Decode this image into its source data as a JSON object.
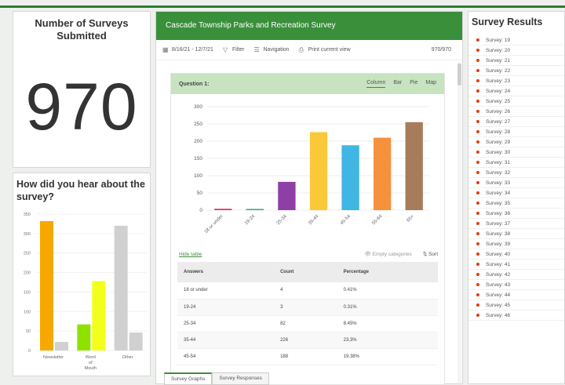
{
  "count_panel": {
    "title": "Number of Surveys Submitted",
    "value": "970"
  },
  "source_panel": {
    "title": "How did you hear about the survey?",
    "chart_data": {
      "type": "bar",
      "categories": [
        "Newsletter",
        "Word of Mouth",
        "Other"
      ],
      "category_labels": [
        "Newsletter",
        "Word\nof\nMouth",
        "Other"
      ],
      "series": [
        {
          "values": [
            332,
            67,
            320
          ],
          "colors": [
            "#f7a800",
            "#8fe200",
            "#d0d0d0"
          ]
        },
        {
          "values": [
            22,
            178,
            46
          ],
          "colors": [
            "#d0d0d0",
            "#f3ff1a",
            "#d0d0d0"
          ]
        }
      ],
      "ylim": [
        0,
        350
      ],
      "yticks": [
        0,
        50,
        100,
        150,
        200,
        250,
        300,
        350
      ]
    }
  },
  "survey": {
    "header": "Cascade Township Parks and Recreation Survey",
    "toolbar": {
      "date_range": "8/16/21 - 12/7/21",
      "filter": "Filter",
      "navigation": "Navigation",
      "print": "Print current view",
      "count": "970/970"
    },
    "question": {
      "title": "Question 1:",
      "tabs": [
        "Column",
        "Bar",
        "Pie",
        "Map"
      ],
      "active_tab": "Column"
    },
    "chart_data": {
      "type": "bar",
      "categories": [
        "18 or under",
        "19-24",
        "25-34",
        "35-44",
        "45-54",
        "55-64",
        "65+"
      ],
      "values": [
        4,
        3,
        82,
        226,
        188,
        210,
        255
      ],
      "colors": [
        "#e0365f",
        "#2aa898",
        "#8e3fa6",
        "#f9c93a",
        "#3fb6e3",
        "#f6913c",
        "#a67c5b"
      ],
      "ylim": [
        0,
        300
      ],
      "yticks": [
        0,
        50,
        100,
        150,
        200,
        250,
        300
      ]
    },
    "hide_table": "Hide table",
    "empty_categories": "Empty categories",
    "sort": "Sort",
    "table": {
      "headers": [
        "Answers",
        "Count",
        "Percentage"
      ],
      "rows": [
        [
          "18 or under",
          "4",
          "0.41%"
        ],
        [
          "19-24",
          "3",
          "0.31%"
        ],
        [
          "25-34",
          "82",
          "8.45%"
        ],
        [
          "35-44",
          "226",
          "23.3%"
        ],
        [
          "45-54",
          "188",
          "19.38%"
        ]
      ]
    },
    "bottom_tabs": [
      "Survey Graphs",
      "Survey Responses"
    ]
  },
  "results": {
    "title": "Survey Results",
    "items": [
      "Survey: 19",
      "Survey: 20",
      "Survey: 21",
      "Survey: 22",
      "Survey: 23",
      "Survey: 24",
      "Survey: 25",
      "Survey: 26",
      "Survey: 27",
      "Survey: 28",
      "Survey: 29",
      "Survey: 30",
      "Survey: 31",
      "Survey: 32",
      "Survey: 33",
      "Survey: 34",
      "Survey: 35",
      "Survey: 36",
      "Survey: 37",
      "Survey: 38",
      "Survey: 39",
      "Survey: 40",
      "Survey: 41",
      "Survey: 42",
      "Survey: 43",
      "Survey: 44",
      "Survey: 45",
      "Survey: 46"
    ]
  }
}
